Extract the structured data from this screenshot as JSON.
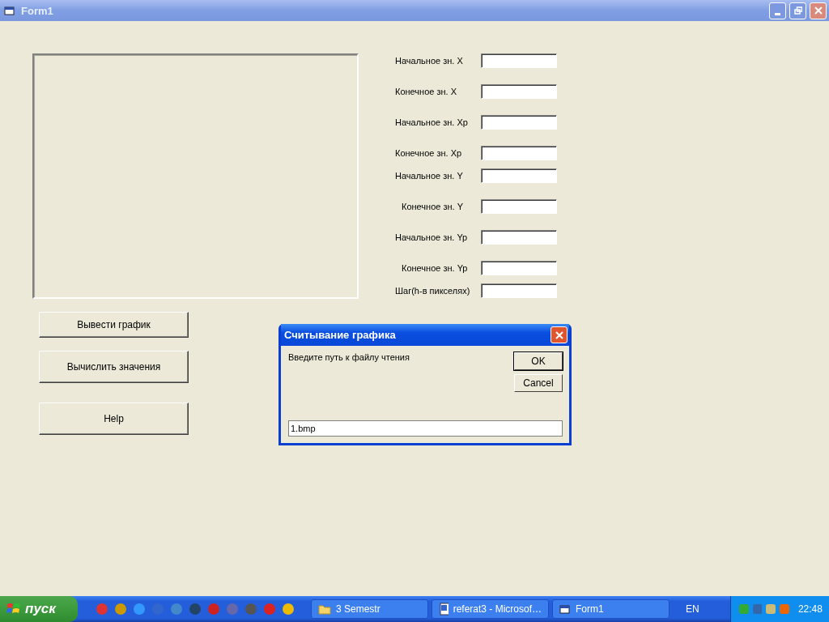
{
  "window": {
    "title": "Form1"
  },
  "fields": [
    {
      "label": "Начальное зн. X"
    },
    {
      "label": "Конечное зн. X"
    },
    {
      "label": "Начальное зн. Xp"
    },
    {
      "label": "Конечное зн. Xp"
    },
    {
      "label": "Начальное зн. Y"
    },
    {
      "label": "Конечное зн. Y"
    },
    {
      "label": "Начальное зн. Yp"
    },
    {
      "label": "Конечное зн. Yp"
    },
    {
      "label": "Шаг(h-в пикселях)"
    }
  ],
  "buttons": [
    "Вывести график",
    "Вычислить значения",
    "Help"
  ],
  "dialog": {
    "title": "Считывание графика",
    "prompt": "Введите путь к файлу чтения",
    "buttons": [
      "OK",
      "Cancel"
    ],
    "value": "1.bmp"
  },
  "taskbar": {
    "start": "пуск",
    "tasks": [
      {
        "label": "3 Semestr",
        "kind": "folder"
      },
      {
        "label": "referat3 - Microsof…",
        "kind": "doc"
      },
      {
        "label": "Form1",
        "kind": "form"
      }
    ],
    "language": "EN",
    "time": "22:48"
  }
}
